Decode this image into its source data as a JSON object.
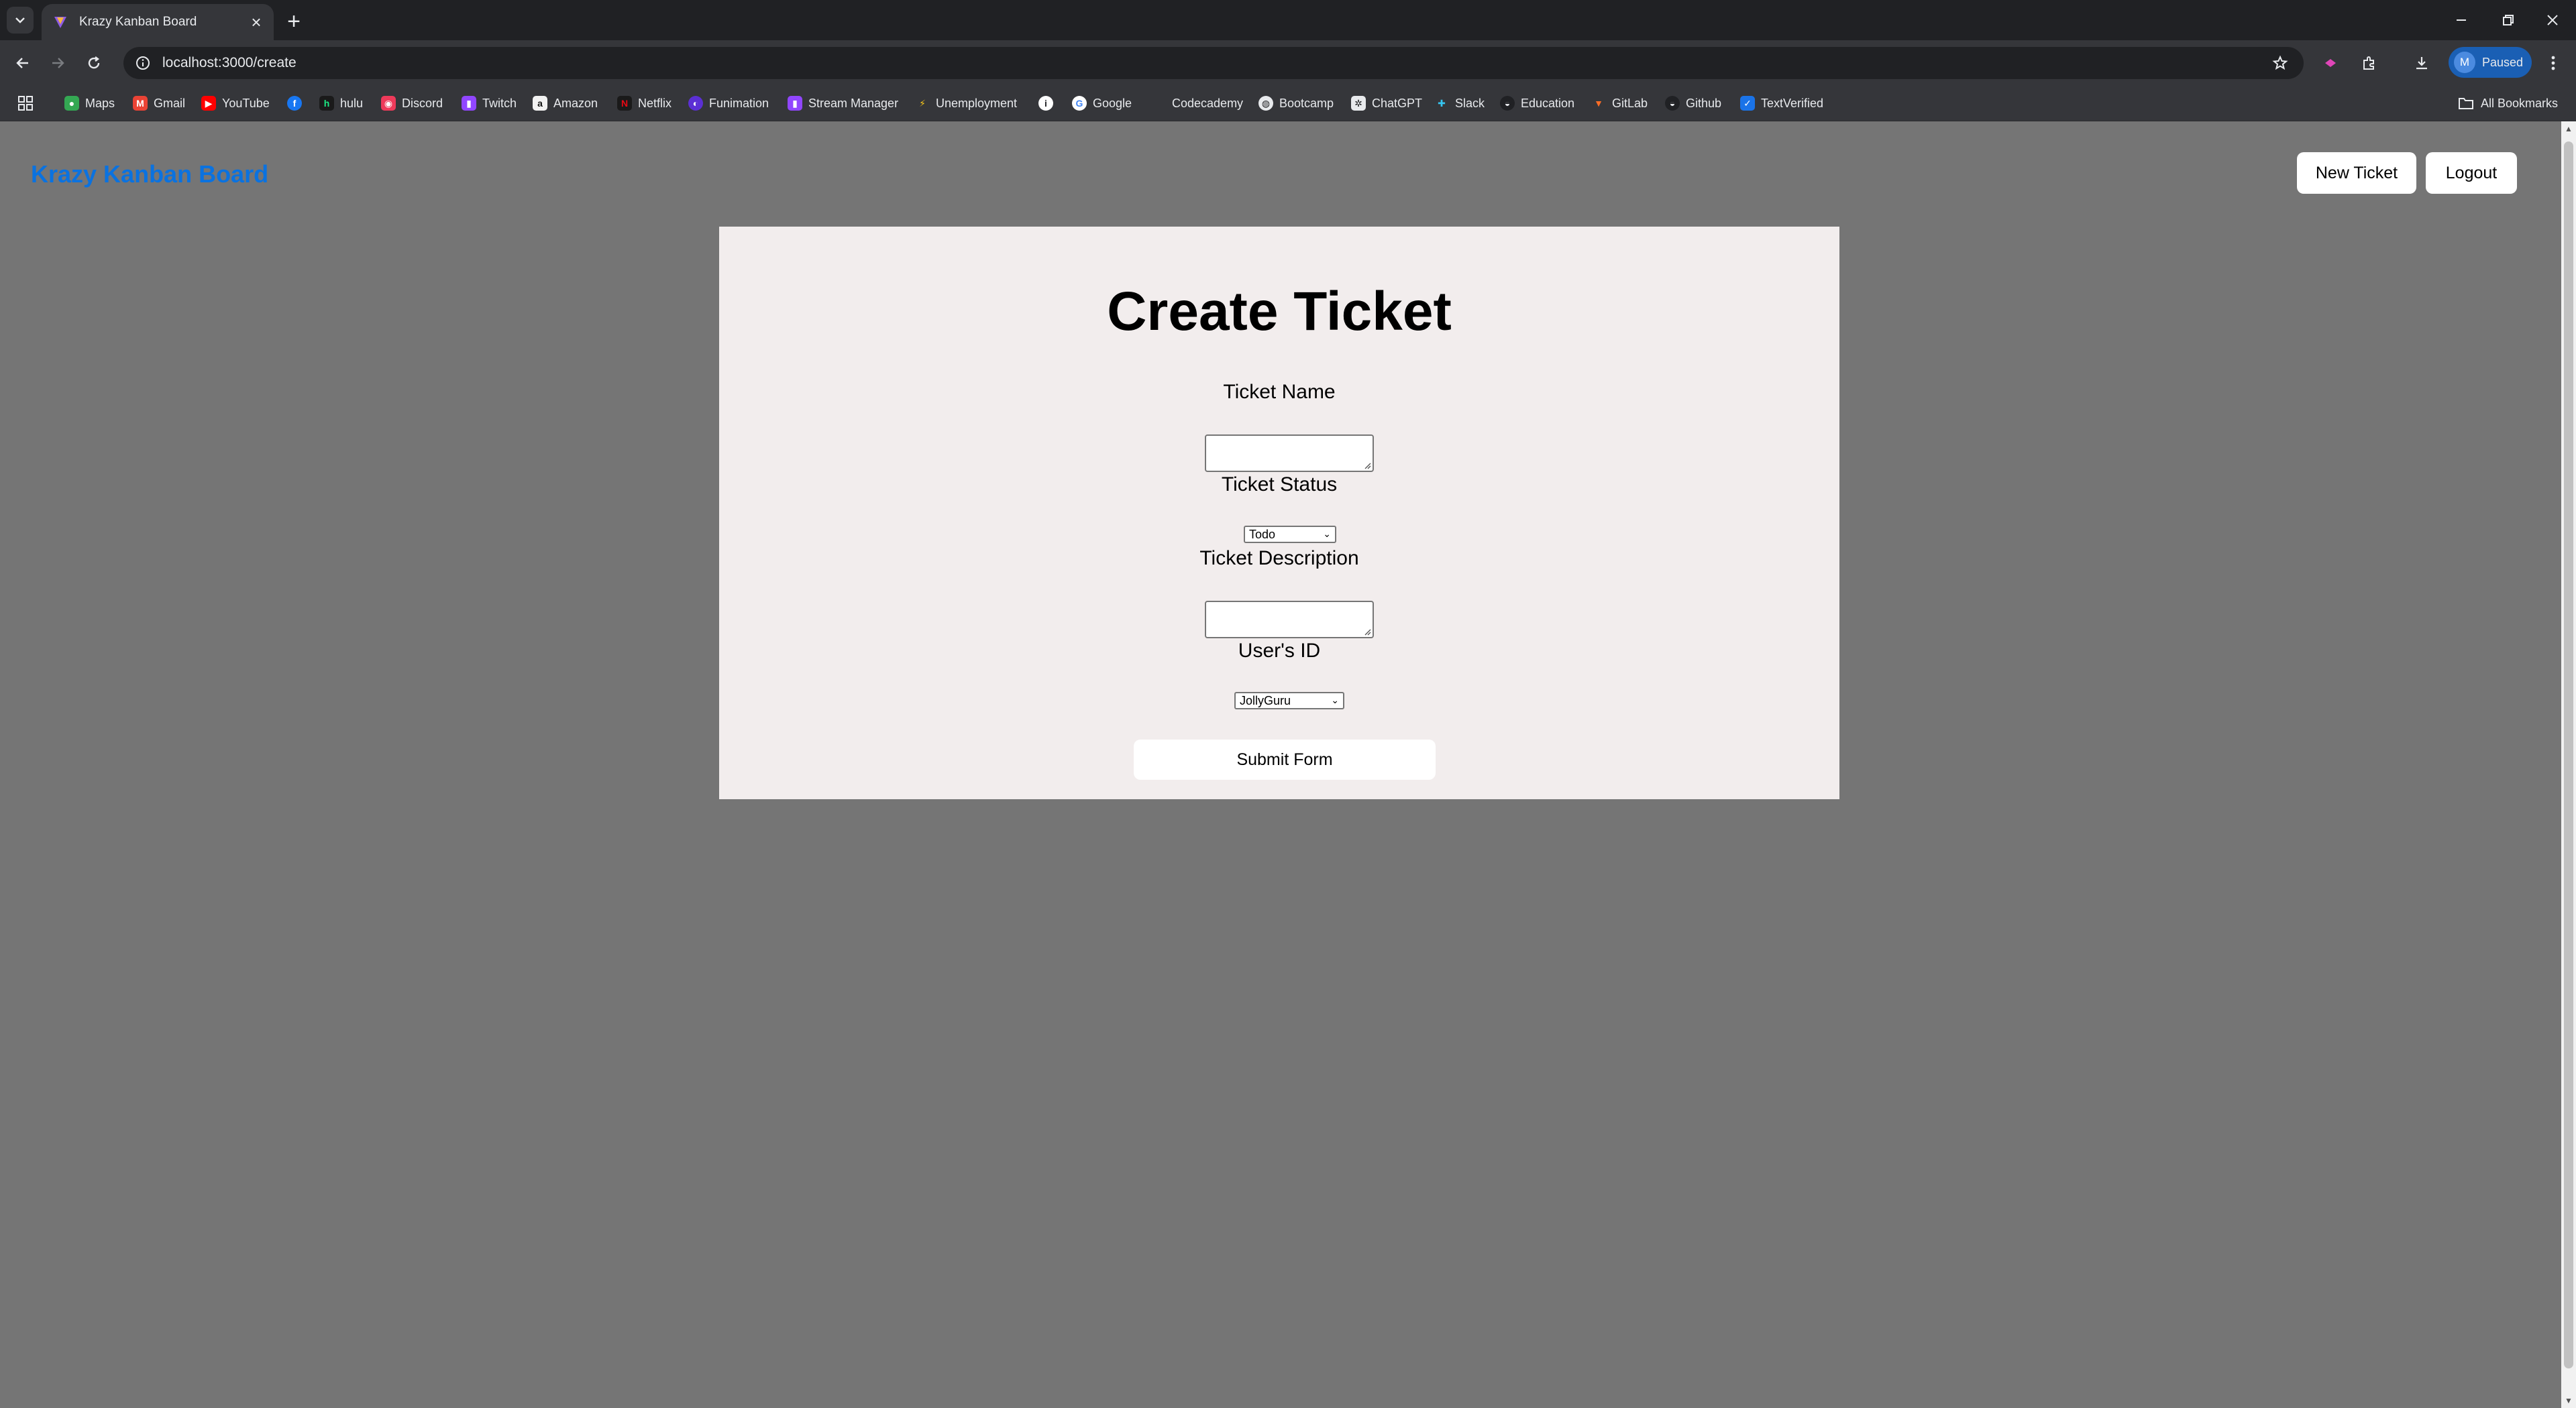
{
  "browser": {
    "tab_title": "Krazy Kanban Board",
    "url": "localhost:3000/create",
    "profile_initial": "M",
    "profile_status": "Paused",
    "all_bookmarks_label": "All Bookmarks",
    "bookmarks": [
      "Maps",
      "Gmail",
      "YouTube",
      "",
      "hulu",
      "Discord",
      "Twitch",
      "Amazon",
      "Netflix",
      "Funimation",
      "Stream Manager",
      "Unemployment",
      "",
      "Google",
      "Codecademy",
      "Bootcamp",
      "ChatGPT",
      "Slack",
      "Education",
      "GitLab",
      "Github",
      "TextVerified"
    ]
  },
  "app": {
    "brand": "Krazy Kanban Board",
    "new_ticket_label": "New Ticket",
    "logout_label": "Logout"
  },
  "form": {
    "title": "Create Ticket",
    "name_label": "Ticket Name",
    "name_value": "",
    "status_label": "Ticket Status",
    "status_value": "Todo",
    "description_label": "Ticket Description",
    "description_value": "",
    "user_label": "User's ID",
    "user_value": "JollyGuru",
    "submit_label": "Submit Form"
  },
  "colors": {
    "brand": "#0a72e0",
    "page_bg": "#757575",
    "card_bg": "#f2eded"
  }
}
